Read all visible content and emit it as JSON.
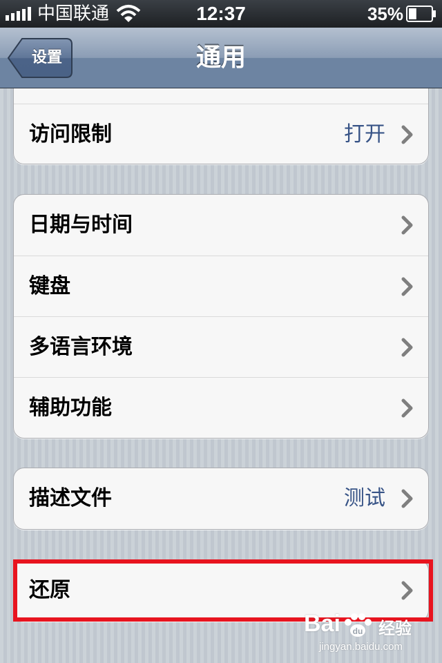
{
  "status_bar": {
    "carrier": "中国联通",
    "time": "12:37",
    "battery_percent": "35%",
    "battery_level": 0.35,
    "icons": [
      "signal-bars-icon",
      "wifi-icon",
      "battery-icon"
    ]
  },
  "nav": {
    "back_label": "设置",
    "title": "通用",
    "bar_color": "#6d84a2"
  },
  "groups": [
    {
      "rows": [
        {
          "label": "访问限制",
          "value": "打开"
        }
      ]
    },
    {
      "rows": [
        {
          "label": "日期与时间"
        },
        {
          "label": "键盘"
        },
        {
          "label": "多语言环境"
        },
        {
          "label": "辅助功能"
        }
      ]
    },
    {
      "rows": [
        {
          "label": "描述文件",
          "value": "测试"
        }
      ]
    },
    {
      "rows": [
        {
          "label": "还原"
        }
      ]
    }
  ],
  "highlight": {
    "target": "还原",
    "color": "#e8141f"
  },
  "watermark": {
    "brand": "Bai",
    "suffix": "经验",
    "url": "jingyan.baidu.com"
  },
  "colors": {
    "value_text": "#385487",
    "chevron": "#7f7f7f",
    "background": "#c5ccd4"
  }
}
